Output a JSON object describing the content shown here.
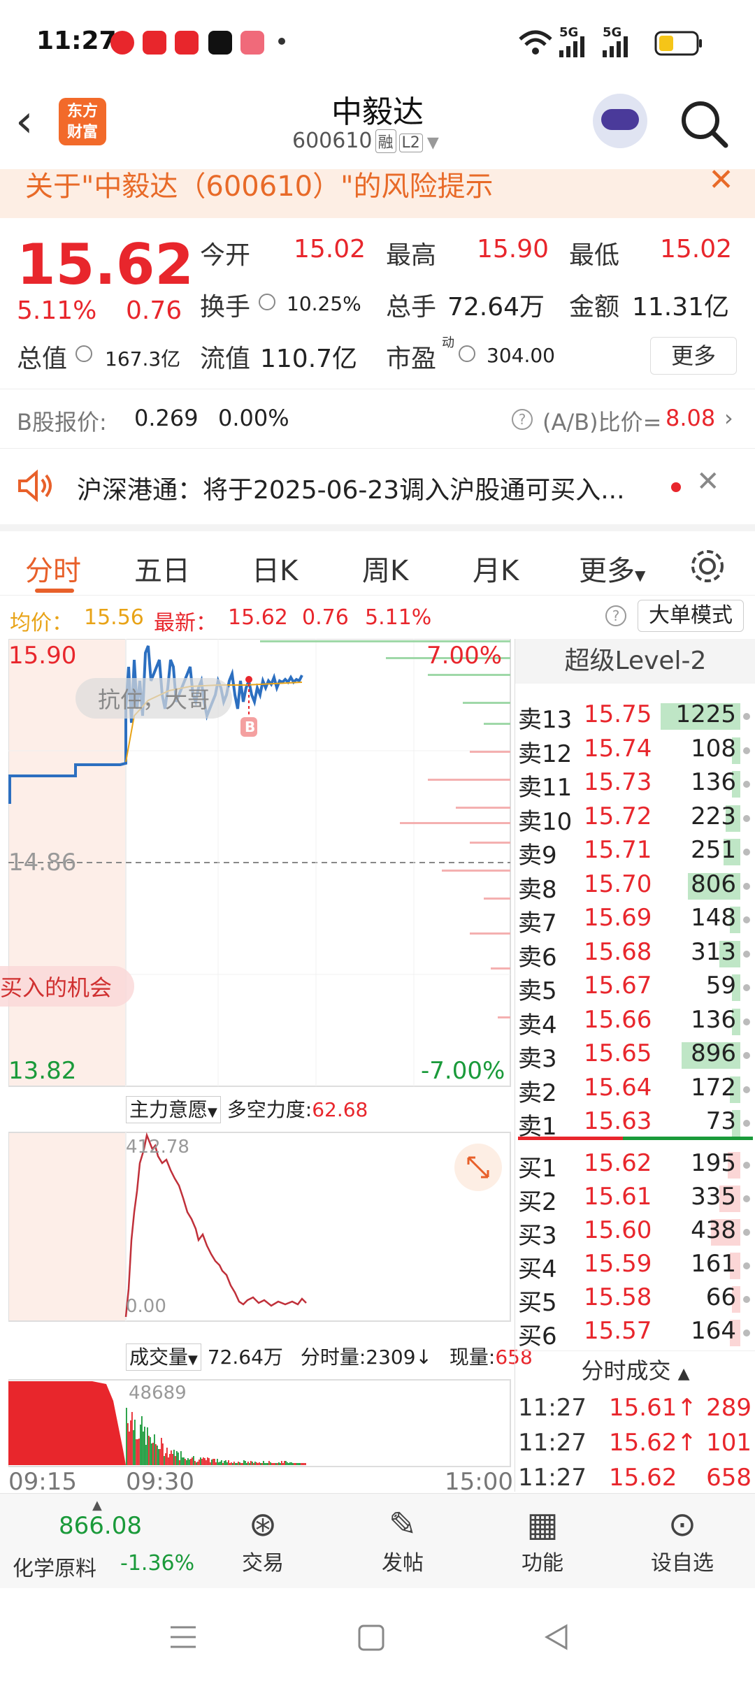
{
  "status": {
    "time": "11:27",
    "net1": "5G",
    "net2": "5G",
    "app_icons": [
      "toutiao-icon",
      "toutiao-icon",
      "capcut-icon",
      "shopping-icon"
    ]
  },
  "header": {
    "stock_name": "中毅达",
    "stock_code": "600610",
    "tag_margin": "融",
    "tag_level": "L2",
    "logo_text_1": "东方",
    "logo_text_2": "财富"
  },
  "risk_banner": {
    "text": "关于\"中毅达（600610）\"的风险提示"
  },
  "quote": {
    "price": "15.62",
    "change_pct": "5.11%",
    "change": "0.76",
    "open_label": "今开",
    "open": "15.02",
    "high_label": "最高",
    "high": "15.90",
    "low_label": "最低",
    "low": "15.02",
    "turnover_label": "换手",
    "turnover": "10.25%",
    "volume_label": "总手",
    "volume": "72.64万",
    "amount_label": "金额",
    "amount": "11.31亿",
    "mktcap_label": "总值",
    "mktcap": "167.3亿",
    "float_label": "流值",
    "float": "110.7亿",
    "pe_label": "市盈",
    "pe_sup": "动",
    "pe": "304.00",
    "more": "更多"
  },
  "bshare": {
    "label": "B股报价:",
    "price": "0.269",
    "pct": "0.00%",
    "ratio_label": "(A/B)比价=",
    "ratio": "8.08"
  },
  "notice": {
    "text": "沪深港通：将于2025-06-23调入沪股通可买入..."
  },
  "tabs": [
    "分时",
    "五日",
    "日K",
    "周K",
    "月K",
    "更多"
  ],
  "avgbar": {
    "avg_label": "均价：",
    "avg": "15.56",
    "latest_label": "最新：",
    "latest": "15.62",
    "chg": "0.76",
    "pct": "5.11%",
    "mode": "大单模式"
  },
  "chart": {
    "y_high": "15.90",
    "y_low": "13.82",
    "y_mid": "14.86",
    "pct_high": "7.00%",
    "pct_low": "-7.00%",
    "marker": "B",
    "bubble1": "抗住，大哥",
    "bubble2": "买入的机会",
    "ind_label": "主力意愿",
    "ind2_label": "多空力度:",
    "ind2_value": "62.68",
    "ind_max": "412.78",
    "ind_min": "0.00",
    "vol_label": "成交量",
    "vol_total": "72.64万",
    "vol_min_label": "分时量:",
    "vol_min": "2309↓",
    "vol_cur_label": "现量:",
    "vol_cur": "658",
    "vol_max": "48689",
    "t_start": "09:15",
    "t_open": "09:30",
    "t_end": "15:00"
  },
  "orderbook": {
    "title": "超级Level-2",
    "asks": [
      {
        "l": "卖13",
        "p": "15.75",
        "v": "1225",
        "w": 0.38
      },
      {
        "l": "卖12",
        "p": "15.74",
        "v": "108",
        "w": 0.03
      },
      {
        "l": "卖11",
        "p": "15.73",
        "v": "136",
        "w": 0.04
      },
      {
        "l": "卖10",
        "p": "15.72",
        "v": "223",
        "w": 0.07
      },
      {
        "l": "卖9",
        "p": "15.71",
        "v": "251",
        "w": 0.08
      },
      {
        "l": "卖8",
        "p": "15.70",
        "v": "806",
        "w": 0.25
      },
      {
        "l": "卖7",
        "p": "15.69",
        "v": "148",
        "w": 0.05
      },
      {
        "l": "卖6",
        "p": "15.68",
        "v": "313",
        "w": 0.1
      },
      {
        "l": "卖5",
        "p": "15.67",
        "v": "59",
        "w": 0.02
      },
      {
        "l": "卖4",
        "p": "15.66",
        "v": "136",
        "w": 0.04
      },
      {
        "l": "卖3",
        "p": "15.65",
        "v": "896",
        "w": 0.28
      },
      {
        "l": "卖2",
        "p": "15.64",
        "v": "172",
        "w": 0.05
      },
      {
        "l": "卖1",
        "p": "15.63",
        "v": "73",
        "w": 0.02
      }
    ],
    "bids": [
      {
        "l": "买1",
        "p": "15.62",
        "v": "195",
        "w": 0.06
      },
      {
        "l": "买2",
        "p": "15.61",
        "v": "335",
        "w": 0.1
      },
      {
        "l": "买3",
        "p": "15.60",
        "v": "438",
        "w": 0.14
      },
      {
        "l": "买4",
        "p": "15.59",
        "v": "161",
        "w": 0.05
      },
      {
        "l": "买5",
        "p": "15.58",
        "v": "66",
        "w": 0.02
      },
      {
        "l": "买6",
        "p": "15.57",
        "v": "164",
        "w": 0.05
      }
    ],
    "trades_title": "分时成交",
    "trades": [
      {
        "t": "11:27",
        "p": "15.61↑",
        "v": "289"
      },
      {
        "t": "11:27",
        "p": "15.62↑",
        "v": "101"
      },
      {
        "t": "11:27",
        "p": "15.62",
        "v": "658"
      }
    ]
  },
  "bottom": {
    "index_value": "866.08",
    "index_name": "化学原料",
    "index_pct": "-1.36%",
    "trade": "交易",
    "post": "发帖",
    "func": "功能",
    "watch": "设自选"
  }
}
